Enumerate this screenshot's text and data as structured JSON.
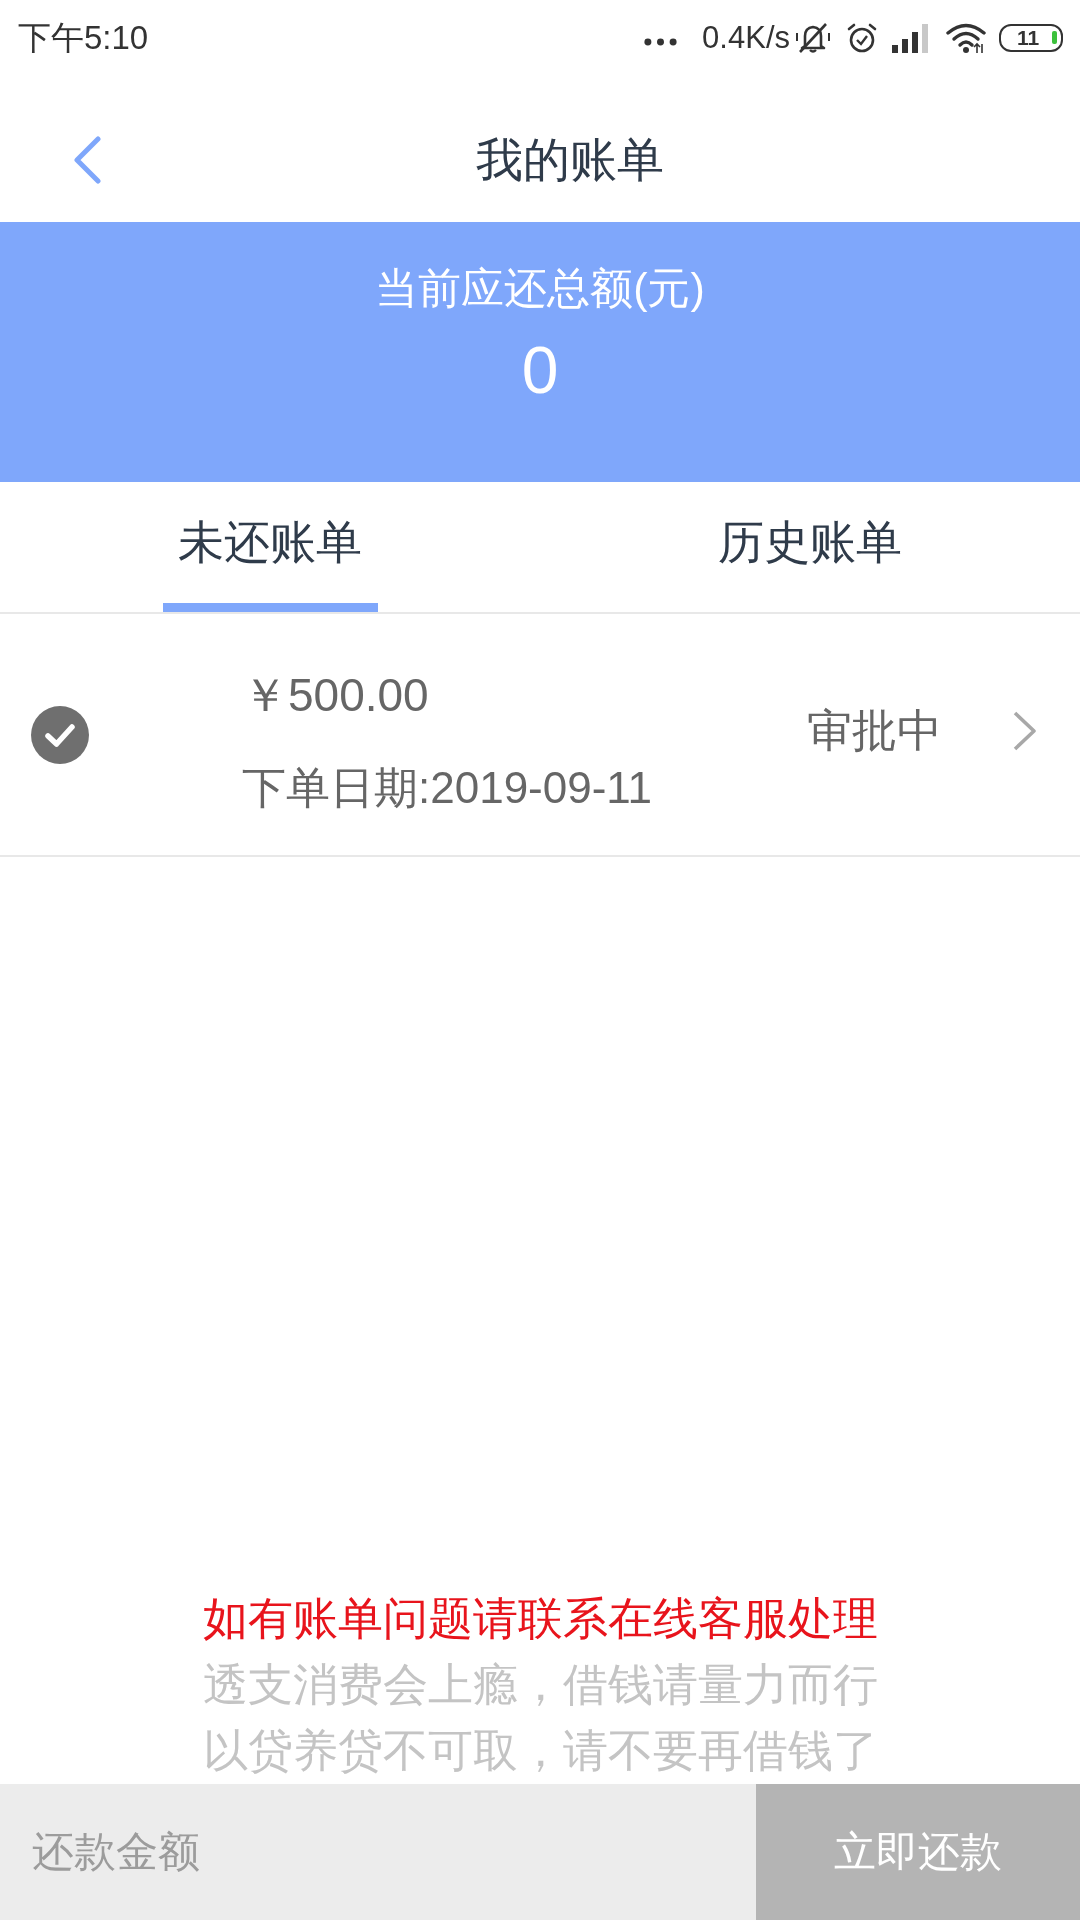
{
  "status_bar": {
    "time": "下午5:10",
    "network_speed": "0.4K/s",
    "battery": "11"
  },
  "header": {
    "title": "我的账单"
  },
  "summary": {
    "label": "当前应还总额(元)",
    "amount": "0"
  },
  "tabs": [
    {
      "label": "未还账单",
      "selected": true
    },
    {
      "label": "历史账单",
      "selected": false
    }
  ],
  "bills": [
    {
      "amount": "￥500.00",
      "date": "下单日期:2019-09-11",
      "status": "审批中",
      "checked": true
    }
  ],
  "notices": [
    {
      "kind": "alert",
      "text": "如有账单问题请联系在线客服处理"
    },
    {
      "kind": "hint",
      "text": "透支消费会上瘾，借钱请量力而行"
    },
    {
      "kind": "hint",
      "text": "以贷养贷不可取，请不要再借钱了"
    }
  ],
  "payment_bar": {
    "amount_field": {
      "placeholder": "还款金额"
    },
    "pay_button": {
      "label": "立即还款",
      "disabled": true
    }
  }
}
